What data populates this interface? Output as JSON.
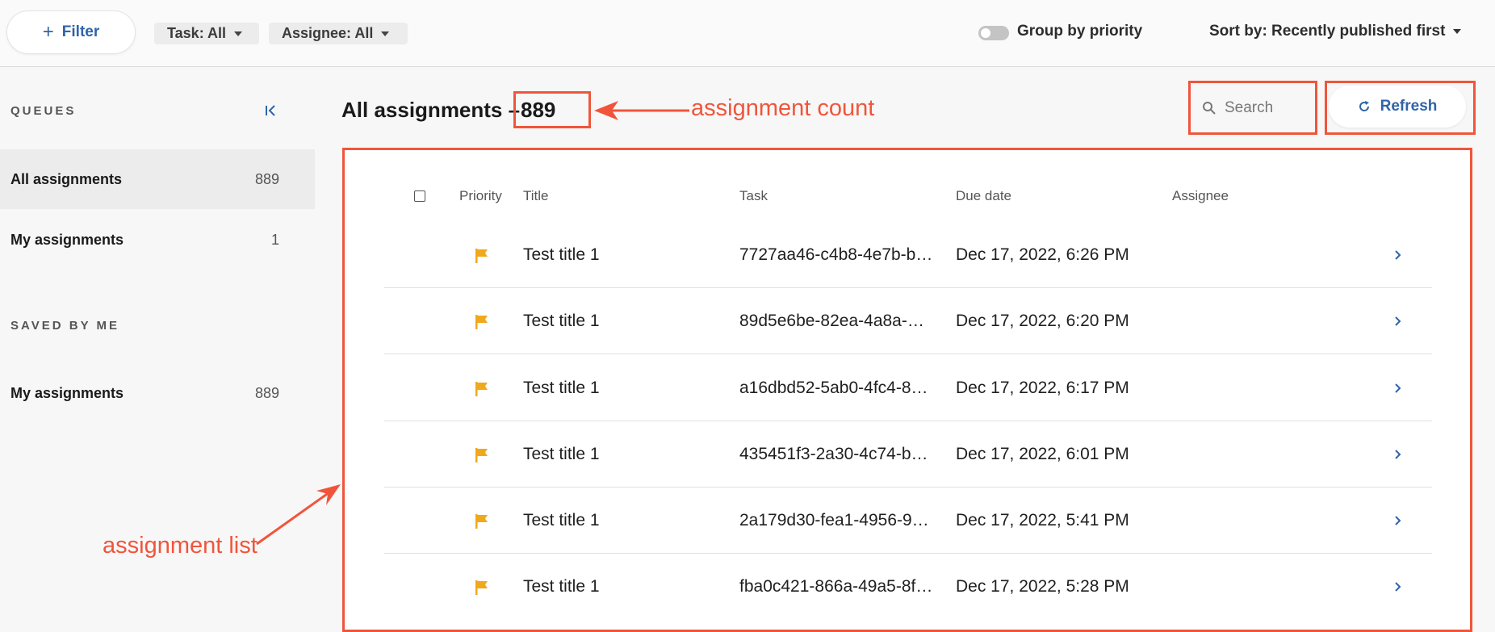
{
  "toolbar": {
    "filter_label": "Filter",
    "task_chip": "Task: All",
    "assignee_chip": "Assignee: All",
    "group_by_label": "Group by priority",
    "sort_label": "Sort by: Recently published first"
  },
  "sidebar": {
    "queues_label": "QUEUES",
    "saved_label": "SAVED BY ME",
    "queues": [
      {
        "label": "All assignments",
        "count": "889"
      },
      {
        "label": "My assignments",
        "count": "1"
      }
    ],
    "saved": [
      {
        "label": "My assignments",
        "count": "889"
      }
    ]
  },
  "main": {
    "title": "All assignments –",
    "count": "889",
    "search_placeholder": "Search",
    "refresh_label": "Refresh"
  },
  "annotations": {
    "count_label": "assignment count",
    "list_label": "assignment list",
    "color": "#f0553b"
  },
  "table": {
    "columns": [
      "Priority",
      "Title",
      "Task",
      "Due date",
      "Assignee"
    ],
    "rows": [
      {
        "title": "Test title 1",
        "task": "7727aa46-c4b8-4e7b-b…",
        "due": "Dec 17, 2022, 6:26 PM",
        "assignee": ""
      },
      {
        "title": "Test title 1",
        "task": "89d5e6be-82ea-4a8a-…",
        "due": "Dec 17, 2022, 6:20 PM",
        "assignee": ""
      },
      {
        "title": "Test title 1",
        "task": "a16dbd52-5ab0-4fc4-8…",
        "due": "Dec 17, 2022, 6:17 PM",
        "assignee": ""
      },
      {
        "title": "Test title 1",
        "task": "435451f3-2a30-4c74-b…",
        "due": "Dec 17, 2022, 6:01 PM",
        "assignee": ""
      },
      {
        "title": "Test title 1",
        "task": "2a179d30-fea1-4956-9…",
        "due": "Dec 17, 2022, 5:41 PM",
        "assignee": ""
      },
      {
        "title": "Test title 1",
        "task": "fba0c421-866a-49a5-8f…",
        "due": "Dec 17, 2022, 5:28 PM",
        "assignee": ""
      }
    ]
  },
  "colors": {
    "accent_blue": "#2f64a8",
    "flag_yellow": "#f0a81c"
  }
}
